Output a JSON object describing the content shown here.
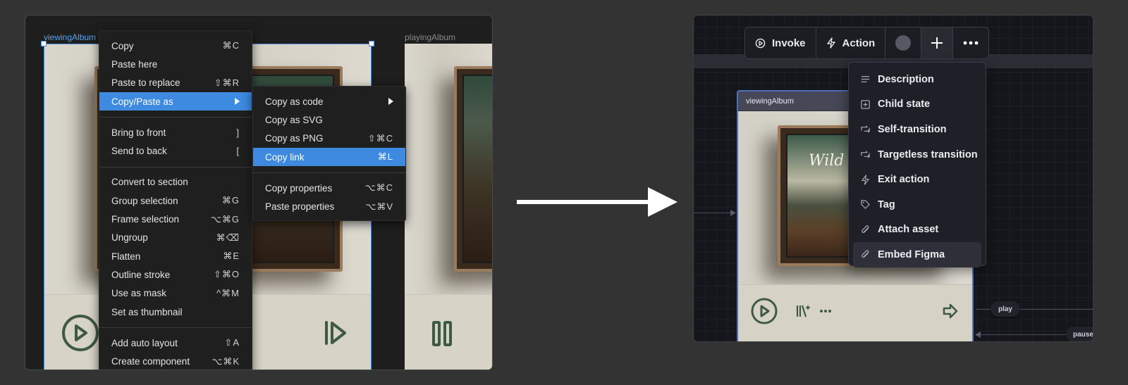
{
  "left_panel": {
    "frames": [
      {
        "label": "viewingAlbum",
        "selected": true
      },
      {
        "label": "playingAlbum",
        "selected": false
      }
    ],
    "context_menu": {
      "items": [
        {
          "label": "Copy",
          "shortcut": "⌘C"
        },
        {
          "label": "Paste here",
          "shortcut": ""
        },
        {
          "label": "Paste to replace",
          "shortcut": "⇧⌘R"
        },
        {
          "label": "Copy/Paste as",
          "shortcut": "",
          "submenu": true,
          "active": true
        },
        {
          "separator": true
        },
        {
          "label": "Bring to front",
          "shortcut": "]"
        },
        {
          "label": "Send to back",
          "shortcut": "["
        },
        {
          "separator": true
        },
        {
          "label": "Convert to section",
          "shortcut": ""
        },
        {
          "label": "Group selection",
          "shortcut": "⌘G"
        },
        {
          "label": "Frame selection",
          "shortcut": "⌥⌘G"
        },
        {
          "label": "Ungroup",
          "shortcut": "⌘⌫"
        },
        {
          "label": "Flatten",
          "shortcut": "⌘E"
        },
        {
          "label": "Outline stroke",
          "shortcut": "⇧⌘O"
        },
        {
          "label": "Use as mask",
          "shortcut": "^⌘M"
        },
        {
          "label": "Set as thumbnail",
          "shortcut": ""
        },
        {
          "separator": true
        },
        {
          "label": "Add auto layout",
          "shortcut": "⇧A"
        },
        {
          "label": "Create component",
          "shortcut": "⌥⌘K"
        }
      ]
    },
    "submenu": {
      "items": [
        {
          "label": "Copy as code",
          "shortcut": "",
          "submenu": true
        },
        {
          "label": "Copy as SVG",
          "shortcut": ""
        },
        {
          "label": "Copy as PNG",
          "shortcut": "⇧⌘C"
        },
        {
          "label": "Copy link",
          "shortcut": "⌘L",
          "active": true
        },
        {
          "separator": true
        },
        {
          "label": "Copy properties",
          "shortcut": "⌥⌘C"
        },
        {
          "label": "Paste properties",
          "shortcut": "⌥⌘V"
        }
      ]
    }
  },
  "right_panel": {
    "toolbar": {
      "invoke_label": "Invoke",
      "action_label": "Action"
    },
    "state_node": {
      "title": "viewingAlbum",
      "album_text": "Wild W"
    },
    "add_menu": {
      "items": [
        {
          "label": "Description",
          "icon": "text-lines-icon"
        },
        {
          "label": "Child state",
          "icon": "plus-square-icon"
        },
        {
          "label": "Self-transition",
          "icon": "repeat-icon"
        },
        {
          "label": "Targetless transition",
          "icon": "repeat-icon"
        },
        {
          "label": "Exit action",
          "icon": "lightning-icon"
        },
        {
          "label": "Tag",
          "icon": "tag-icon"
        },
        {
          "label": "Attach asset",
          "icon": "paperclip-icon"
        },
        {
          "label": "Embed Figma",
          "icon": "paperclip-icon",
          "hover": true
        }
      ]
    },
    "edges": [
      {
        "label": "play"
      },
      {
        "label": "pause"
      }
    ]
  },
  "colors": {
    "menu_active": "#3d8ae0",
    "selection": "#4c8de0",
    "control_green": "#3e5a45",
    "state_border": "#4f70b8"
  }
}
